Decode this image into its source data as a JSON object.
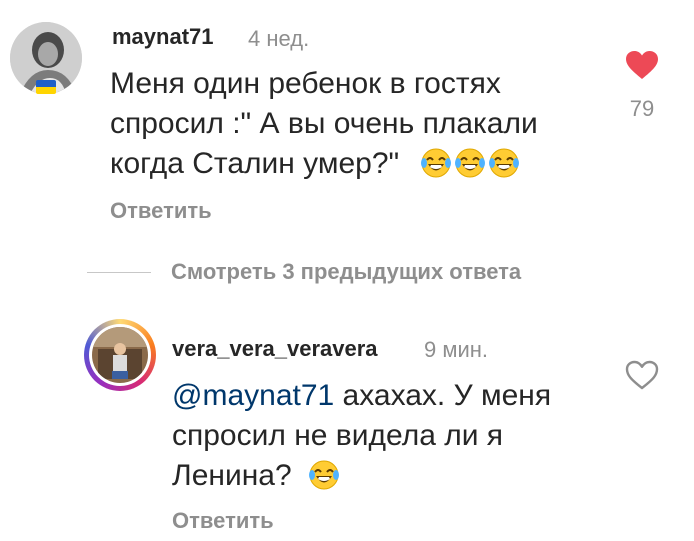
{
  "comments": [
    {
      "username": "maynat71",
      "time": "4 нед.",
      "lines": [
        "Меня один ребенок в гостях",
        "спросил :\" А вы очень плакали",
        "когда Сталин умер?\""
      ],
      "emoji": [
        "laughing-tears-emoji",
        "laughing-tears-emoji",
        "laughing-tears-emoji"
      ],
      "likes": "79",
      "liked": true,
      "reply_label": "Ответить"
    },
    {
      "username": "vera_vera_veravera",
      "time": "9 мин.",
      "mention": "@maynat71",
      "line1_rest": " ахахах. У меня",
      "lines": [
        "спросил не видела ли я",
        "Ленина?"
      ],
      "emoji": [
        "laughing-tears-emoji"
      ],
      "liked": false,
      "reply_label": "Ответить"
    }
  ],
  "view_replies_label": "Смотреть 3 предыдущих ответа",
  "colors": {
    "like_red": "#ed4956",
    "mention_blue": "#00376b",
    "muted": "#8e8e8e",
    "text": "#262626"
  }
}
